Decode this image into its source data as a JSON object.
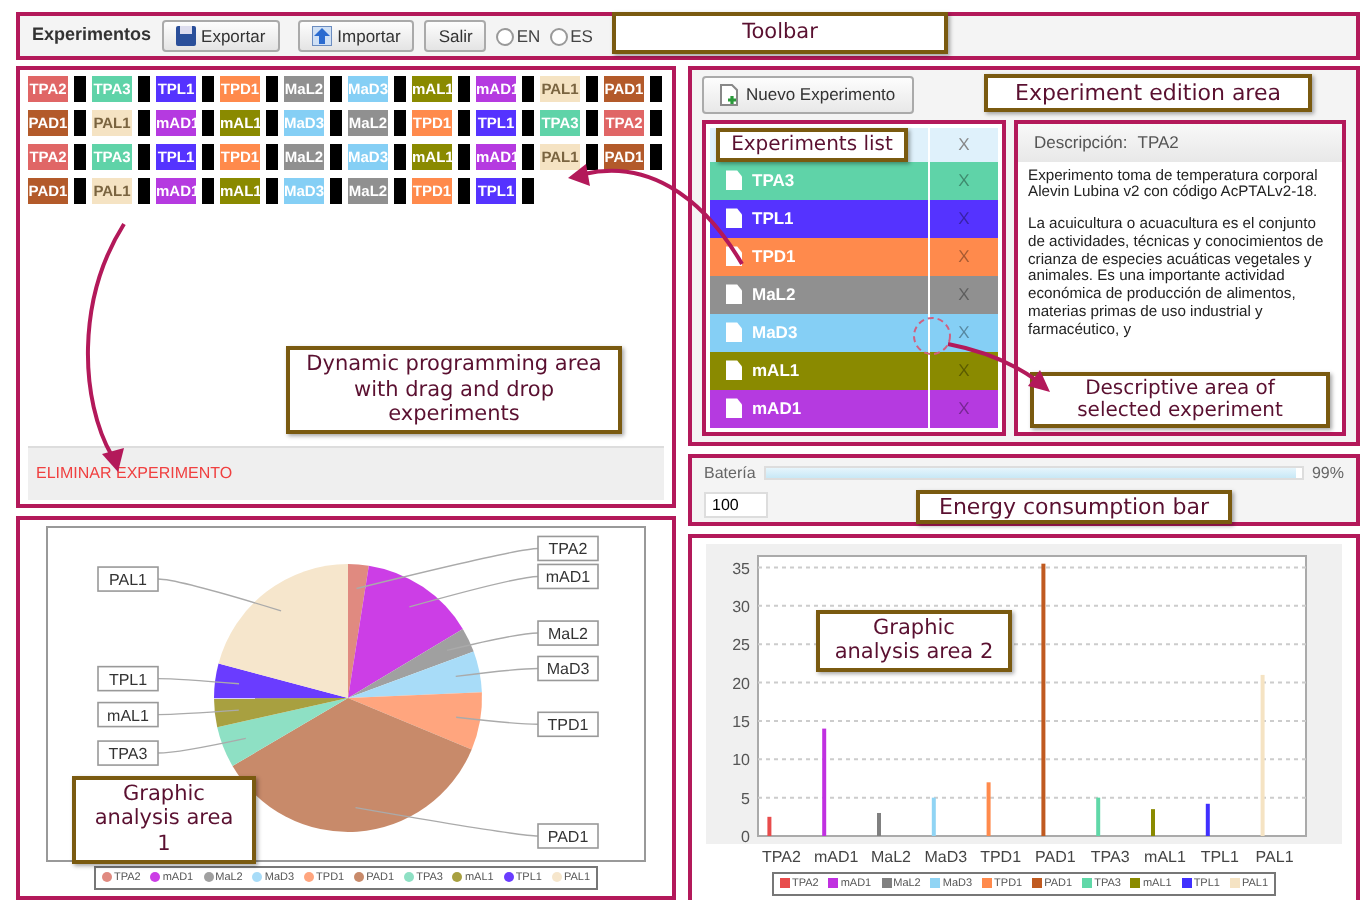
{
  "toolbar": {
    "title": "Experimentos",
    "annotation": "Toolbar",
    "buttons": [
      {
        "label": "Exportar",
        "kind": "export"
      },
      {
        "label": "Importar",
        "kind": "import"
      },
      {
        "label": "Salir",
        "kind": "plain"
      }
    ],
    "languages": [
      {
        "label": "EN",
        "selected": false
      },
      {
        "label": "ES",
        "selected": false
      }
    ]
  },
  "programming_area": {
    "annotation": "Dynamic programming area with drag and drop experiments",
    "delete_label": "ELIMINAR EXPERIMENTO",
    "rows": [
      [
        {
          "label": "TPA2",
          "color": "#e06666"
        },
        {
          "label": "TPA3",
          "color": "#5fd3a8"
        },
        {
          "label": "TPL1",
          "color": "#5533ff"
        },
        {
          "label": "TPD1",
          "color": "#ff8a4c"
        },
        {
          "label": "MaL2",
          "color": "#909090"
        },
        {
          "label": "MaD3",
          "color": "#85cff5"
        },
        {
          "label": "mAL1",
          "color": "#8a8a00"
        },
        {
          "label": "mAD1",
          "color": "#b53ae0"
        },
        {
          "label": "PAL1",
          "color": "#f5e3c3"
        },
        {
          "label": "PAD1",
          "color": "#b35a2a"
        }
      ],
      [
        {
          "label": "PAD1",
          "color": "#b35a2a"
        },
        {
          "label": "PAL1",
          "color": "#f5e3c3"
        },
        {
          "label": "mAD1",
          "color": "#b53ae0"
        },
        {
          "label": "mAL1",
          "color": "#8a8a00"
        },
        {
          "label": "MaD3",
          "color": "#85cff5"
        },
        {
          "label": "MaL2",
          "color": "#909090"
        },
        {
          "label": "TPD1",
          "color": "#ff8a4c"
        },
        {
          "label": "TPL1",
          "color": "#5533ff"
        },
        {
          "label": "TPA3",
          "color": "#5fd3a8"
        },
        {
          "label": "TPA2",
          "color": "#e06666"
        }
      ],
      [
        {
          "label": "TPA2",
          "color": "#e06666"
        },
        {
          "label": "TPA3",
          "color": "#5fd3a8"
        },
        {
          "label": "TPL1",
          "color": "#5533ff"
        },
        {
          "label": "TPD1",
          "color": "#ff8a4c"
        },
        {
          "label": "MaL2",
          "color": "#909090"
        },
        {
          "label": "MaD3",
          "color": "#85cff5"
        },
        {
          "label": "mAL1",
          "color": "#8a8a00"
        },
        {
          "label": "mAD1",
          "color": "#b53ae0"
        },
        {
          "label": "PAL1",
          "color": "#f5e3c3"
        },
        {
          "label": "PAD1",
          "color": "#b35a2a"
        }
      ],
      [
        {
          "label": "PAD1",
          "color": "#b35a2a"
        },
        {
          "label": "PAL1",
          "color": "#f5e3c3"
        },
        {
          "label": "mAD1",
          "color": "#b53ae0"
        },
        {
          "label": "mAL1",
          "color": "#8a8a00"
        },
        {
          "label": "MaD3",
          "color": "#85cff5"
        },
        {
          "label": "MaL2",
          "color": "#909090"
        },
        {
          "label": "TPD1",
          "color": "#ff8a4c"
        },
        {
          "label": "TPL1",
          "color": "#5533ff"
        }
      ]
    ]
  },
  "edition_area": {
    "new_button": "Nuevo Experimento",
    "annotation": "Experiment edition area",
    "list": {
      "annotation": "Experiments list",
      "header_remove": "X",
      "items": [
        {
          "label": "TPA3",
          "color": "#5fd3a8",
          "remove": "X"
        },
        {
          "label": "TPL1",
          "color": "#5533ff",
          "remove": "X"
        },
        {
          "label": "TPD1",
          "color": "#ff8a4c",
          "remove": "X"
        },
        {
          "label": "MaL2",
          "color": "#909090",
          "remove": "X"
        },
        {
          "label": "MaD3",
          "color": "#85cff5",
          "remove": "X"
        },
        {
          "label": "mAL1",
          "color": "#8a8a00",
          "remove": "X"
        },
        {
          "label": "mAD1",
          "color": "#b53ae0",
          "remove": "X"
        }
      ]
    },
    "description": {
      "label": "Descripción:",
      "name": "TPA2",
      "annotation": "Descriptive area of selected experiment",
      "paragraphs": [
        "Experimento toma de temperatura corporal Alevin Lubina v2 con código AcPTALv2-18.",
        "La acuicultura o acuacultura es el conjunto de actividades, técnicas y conocimientos de crianza de especies acuáticas vegetales y animales. Es una importante actividad económica de producción de alimentos, materias primas de uso industrial y farmacéutico, y"
      ]
    }
  },
  "energy": {
    "label": "Batería",
    "level": 0.99,
    "reading": "99%",
    "value": "100",
    "annotation": "Energy consumption bar"
  },
  "pie_panel": {
    "annotation": "Graphic analysis area 1",
    "legend": [
      {
        "label": "TPA2",
        "color": "#e08a80"
      },
      {
        "label": "mAD1",
        "color": "#cc3ee6"
      },
      {
        "label": "MaL2",
        "color": "#a0a0a0"
      },
      {
        "label": "MaD3",
        "color": "#a8dcf8"
      },
      {
        "label": "TPD1",
        "color": "#ffa57e"
      },
      {
        "label": "PAD1",
        "color": "#c88a6a"
      },
      {
        "label": "TPA3",
        "color": "#8ee0c4"
      },
      {
        "label": "mAL1",
        "color": "#a8a040"
      },
      {
        "label": "TPL1",
        "color": "#6a3cff"
      },
      {
        "label": "PAL1",
        "color": "#f6e6cc"
      }
    ],
    "chart_data": {
      "type": "pie",
      "categories": [
        "TPA2",
        "mAD1",
        "MaL2",
        "MaD3",
        "TPD1",
        "PAD1",
        "TPA3",
        "mAL1",
        "TPL1",
        "PAL1"
      ],
      "values": [
        2.5,
        14,
        3,
        5,
        7,
        35.5,
        5,
        3.5,
        4.2,
        21
      ]
    }
  },
  "bar_panel": {
    "annotation": "Graphic analysis area 2",
    "legend": [
      {
        "label": "TPA2",
        "color": "#e84c4c"
      },
      {
        "label": "mAD1",
        "color": "#c030e0"
      },
      {
        "label": "MaL2",
        "color": "#808080"
      },
      {
        "label": "MaD3",
        "color": "#90d4f4"
      },
      {
        "label": "TPD1",
        "color": "#ff8a4c"
      },
      {
        "label": "PAD1",
        "color": "#c05a20"
      },
      {
        "label": "TPA3",
        "color": "#60d8a8"
      },
      {
        "label": "mAL1",
        "color": "#8a8a00"
      },
      {
        "label": "TPL1",
        "color": "#4030ff"
      },
      {
        "label": "PAL1",
        "color": "#f5e3c3"
      }
    ],
    "chart_data": {
      "type": "bar",
      "categories": [
        "TPA2",
        "mAD1",
        "MaL2",
        "MaD3",
        "TPD1",
        "PAD1",
        "TPA3",
        "mAL1",
        "TPL1",
        "PAL1"
      ],
      "values": [
        2.5,
        14,
        3,
        5,
        7,
        35.5,
        5,
        3.5,
        4.2,
        21
      ],
      "ylim": [
        0,
        36.5
      ],
      "yticks": [
        0,
        5,
        10,
        15,
        20,
        25,
        30,
        35
      ],
      "grid": true
    }
  }
}
